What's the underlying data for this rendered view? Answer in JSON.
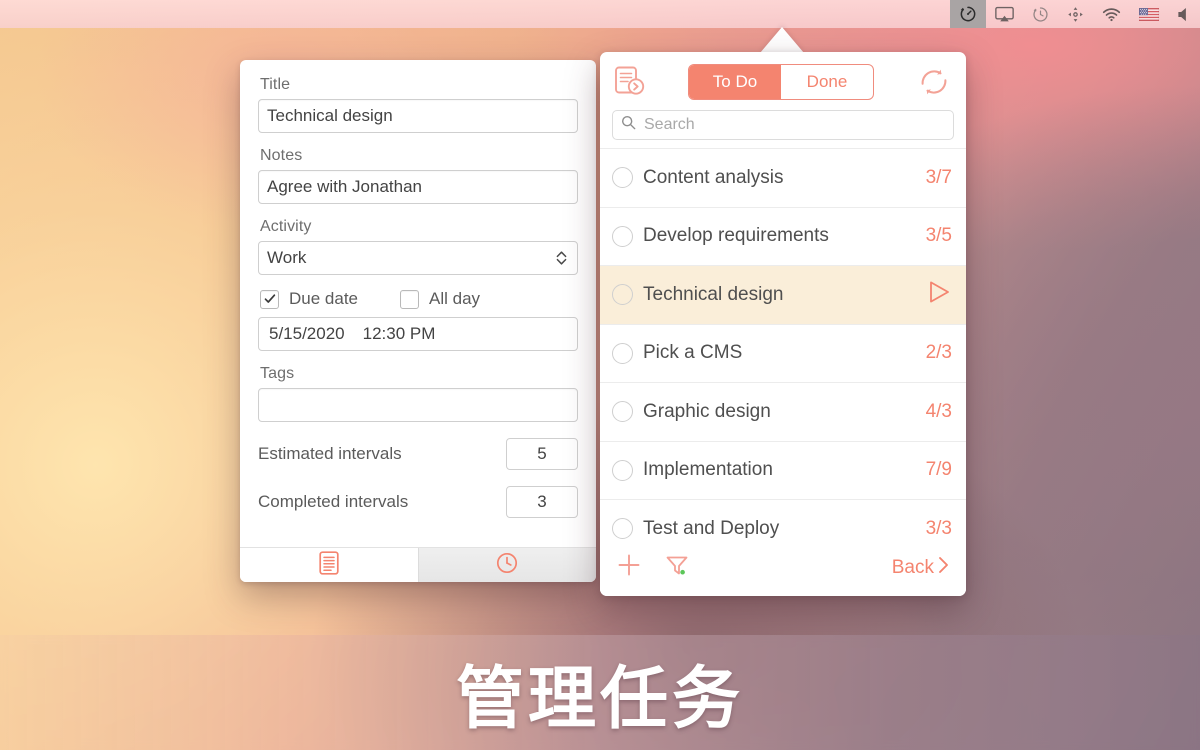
{
  "caption": "管理任务",
  "menubar": {
    "items": [
      {
        "name": "pomodoro-timer",
        "label": "Pomodoro timer",
        "active": true
      },
      {
        "name": "airplay",
        "label": "AirPlay",
        "active": false
      },
      {
        "name": "time-machine",
        "label": "Time Machine",
        "active": false
      },
      {
        "name": "spaces",
        "label": "Spaces",
        "active": false
      },
      {
        "name": "wifi",
        "label": "Wi-Fi",
        "active": false
      },
      {
        "name": "input-flag",
        "label": "US keyboard",
        "active": false
      },
      {
        "name": "volume",
        "label": "Volume",
        "active": false
      }
    ]
  },
  "detail": {
    "title_label": "Title",
    "title_value": "Technical design",
    "notes_label": "Notes",
    "notes_value": "Agree with Jonathan",
    "activity_label": "Activity",
    "activity_value": "Work",
    "due_date_label": "Due date",
    "due_date_checked": true,
    "all_day_label": "All day",
    "all_day_checked": false,
    "date_value": "5/15/2020",
    "time_value": "12:30 PM",
    "tags_label": "Tags",
    "tags_value": "",
    "estimated_label": "Estimated intervals",
    "estimated_value": "5",
    "completed_label": "Completed intervals",
    "completed_value": "3",
    "tabs": [
      {
        "name": "tab-details",
        "icon": "document-icon",
        "selected": true
      },
      {
        "name": "tab-history",
        "icon": "clock-icon",
        "selected": false
      }
    ]
  },
  "popover": {
    "list_icon": "document-forward-icon",
    "sync_icon": "sync-icon",
    "segments": [
      {
        "label": "To Do",
        "selected": true
      },
      {
        "label": "Done",
        "selected": false
      }
    ],
    "search": {
      "icon": "search-icon",
      "placeholder": "Search",
      "value": ""
    },
    "tasks": [
      {
        "title": "Content analysis",
        "count": "3/7",
        "highlighted": false,
        "running": false
      },
      {
        "title": "Develop requirements",
        "count": "3/5",
        "highlighted": false,
        "running": false
      },
      {
        "title": "Technical design",
        "count": "",
        "highlighted": true,
        "running": true
      },
      {
        "title": "Pick a CMS",
        "count": "2/3",
        "highlighted": false,
        "running": false
      },
      {
        "title": "Graphic design",
        "count": "4/3",
        "highlighted": false,
        "running": false
      },
      {
        "title": "Implementation",
        "count": "7/9",
        "highlighted": false,
        "running": false
      },
      {
        "title": "Test and Deploy",
        "count": "3/3",
        "highlighted": false,
        "running": false
      }
    ],
    "footer": {
      "add_icon": "plus-icon",
      "filter_icon": "funnel-icon",
      "filter_active_dot": "#5cc659",
      "back_label": "Back"
    }
  },
  "colors": {
    "accent": "#f4846f",
    "highlight_row": "#faeed9",
    "text": "#4f4f4f",
    "muted": "#a9a9a9"
  }
}
